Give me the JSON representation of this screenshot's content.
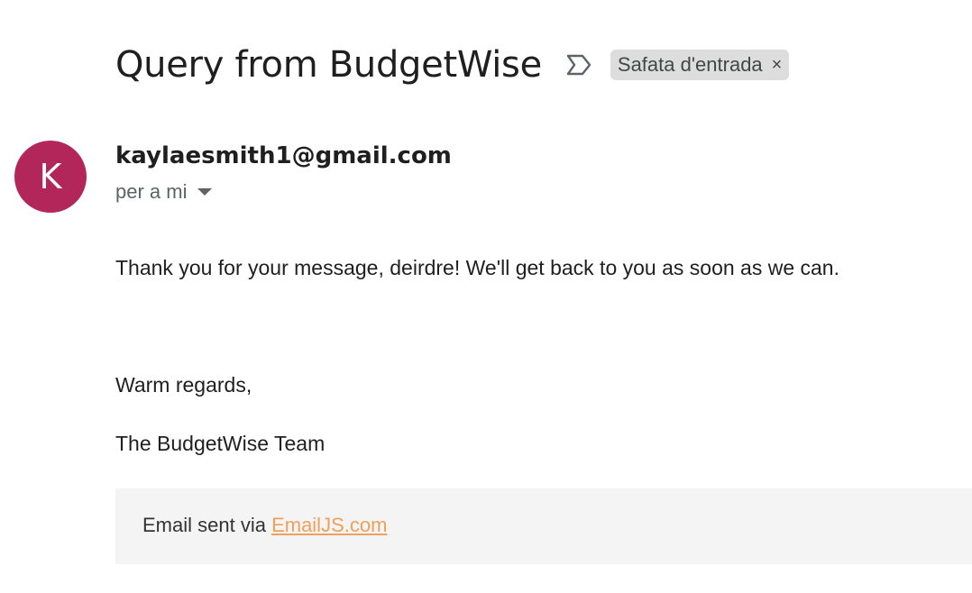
{
  "email": {
    "subject": "Query from BudgetWise",
    "label": "Safata d'entrada",
    "label_close": "×",
    "avatar_letter": "K",
    "avatar_color": "#b3265a",
    "sender": "kaylaesmith1@gmail.com",
    "recipient": "per a mi",
    "body": {
      "line1": "Thank you for your message, deirdre! We'll get back to you as soon as we can.",
      "line2": "Warm regards,",
      "line3": "The BudgetWise Team"
    },
    "footer": {
      "prefix": "Email sent via ",
      "link_text": "EmailJS.com",
      "link_color": "#f0a05a"
    }
  }
}
